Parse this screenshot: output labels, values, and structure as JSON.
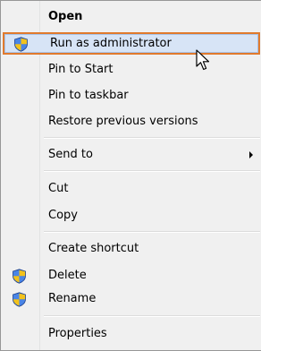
{
  "menu": {
    "items": [
      {
        "label": "Open"
      },
      {
        "label": "Run as administrator"
      },
      {
        "label": "Pin to Start"
      },
      {
        "label": "Pin to taskbar"
      },
      {
        "label": "Restore previous versions"
      },
      {
        "label": "Send to"
      },
      {
        "label": "Cut"
      },
      {
        "label": "Copy"
      },
      {
        "label": "Create shortcut"
      },
      {
        "label": "Delete"
      },
      {
        "label": "Rename"
      },
      {
        "label": "Properties"
      }
    ],
    "icons": {
      "uac_shield": "uac-shield-icon",
      "submenu_arrow": "chevron-right-icon",
      "cursor": "mouse-pointer-icon"
    },
    "colors": {
      "highlight_background": "#d7e4f6",
      "highlight_outline": "#e07a2d",
      "menu_background": "#f0f0f0"
    }
  }
}
